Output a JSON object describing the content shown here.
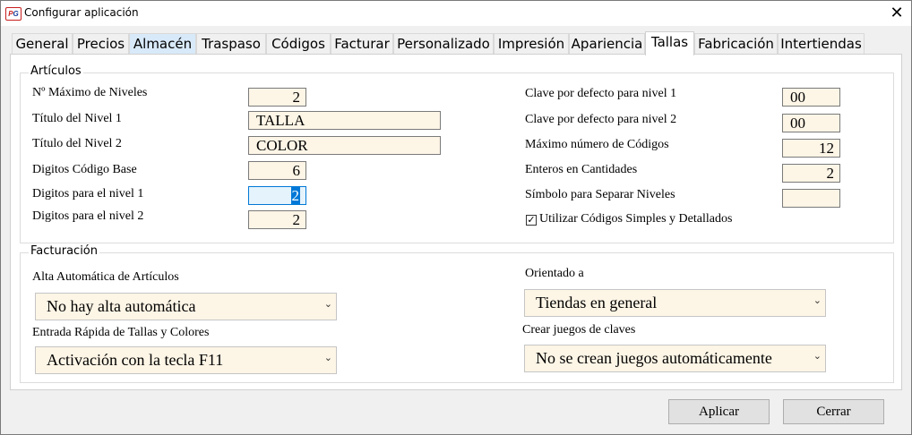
{
  "window": {
    "title": "Configurar aplicación",
    "icon": {
      "name": "app-logo-icon",
      "letters_primary": "P",
      "letters_secondary": "G"
    },
    "close_glyph": "✕"
  },
  "tabs": [
    {
      "label": "General"
    },
    {
      "label": "Precios"
    },
    {
      "label": "Almacén"
    },
    {
      "label": "Traspaso"
    },
    {
      "label": "Códigos"
    },
    {
      "label": "Facturar"
    },
    {
      "label": "Personalizado"
    },
    {
      "label": "Impresión"
    },
    {
      "label": "Apariencia"
    },
    {
      "label": "Tallas"
    },
    {
      "label": "Fabricación"
    },
    {
      "label": "Intertiendas"
    }
  ],
  "active_tab": "Tallas",
  "articulos": {
    "legend": "Artículos",
    "max_niveles": {
      "label": "Nº Máximo de Niveles",
      "value": "2"
    },
    "titulo_nivel1": {
      "label": "Título del Nivel 1",
      "value": "TALLA"
    },
    "titulo_nivel2": {
      "label": "Título del Nivel 2",
      "value": "COLOR"
    },
    "digitos_base": {
      "label": "Digitos Código Base",
      "value": "6"
    },
    "digitos_nivel1": {
      "label": "Digitos para el nivel 1",
      "value": "2"
    },
    "digitos_nivel2": {
      "label": "Digitos para el nivel 2",
      "value": "2"
    },
    "clave_nivel1": {
      "label": "Clave por defecto para nivel 1",
      "value": "00"
    },
    "clave_nivel2": {
      "label": "Clave por defecto para nivel 2",
      "value": "00"
    },
    "max_codigos": {
      "label": "Máximo número de Códigos",
      "value": "12"
    },
    "enteros_cantidades": {
      "label": "Enteros en Cantidades",
      "value": "2"
    },
    "simbolo_separar": {
      "label": "Símbolo para Separar Niveles",
      "value": ""
    },
    "codigos_simples": {
      "label": "Utilizar Códigos Simples y Detallados",
      "checked": true,
      "check_glyph": "✓"
    }
  },
  "facturacion": {
    "legend": "Facturación",
    "alta_automatica": {
      "label": "Alta Automática de Artículos",
      "value": "No hay alta automática"
    },
    "entrada_rapida": {
      "label": "Entrada Rápida de Tallas y Colores",
      "value": "Activación con la tecla F11"
    },
    "orientado": {
      "label": "Orientado a",
      "value": "Tiendas en general"
    },
    "crear_juegos": {
      "label": "Crear juegos de claves",
      "value": "No se crean juegos automáticamente"
    }
  },
  "combo_arrow_glyph": "⌄",
  "buttons": {
    "apply": "Aplicar",
    "close": "Cerrar"
  },
  "colors": {
    "field_bg": "#fdf5e6",
    "focus_bg": "#e5f3fc",
    "accent": "#0078d7",
    "hover_tab": "#d8eaf9"
  }
}
